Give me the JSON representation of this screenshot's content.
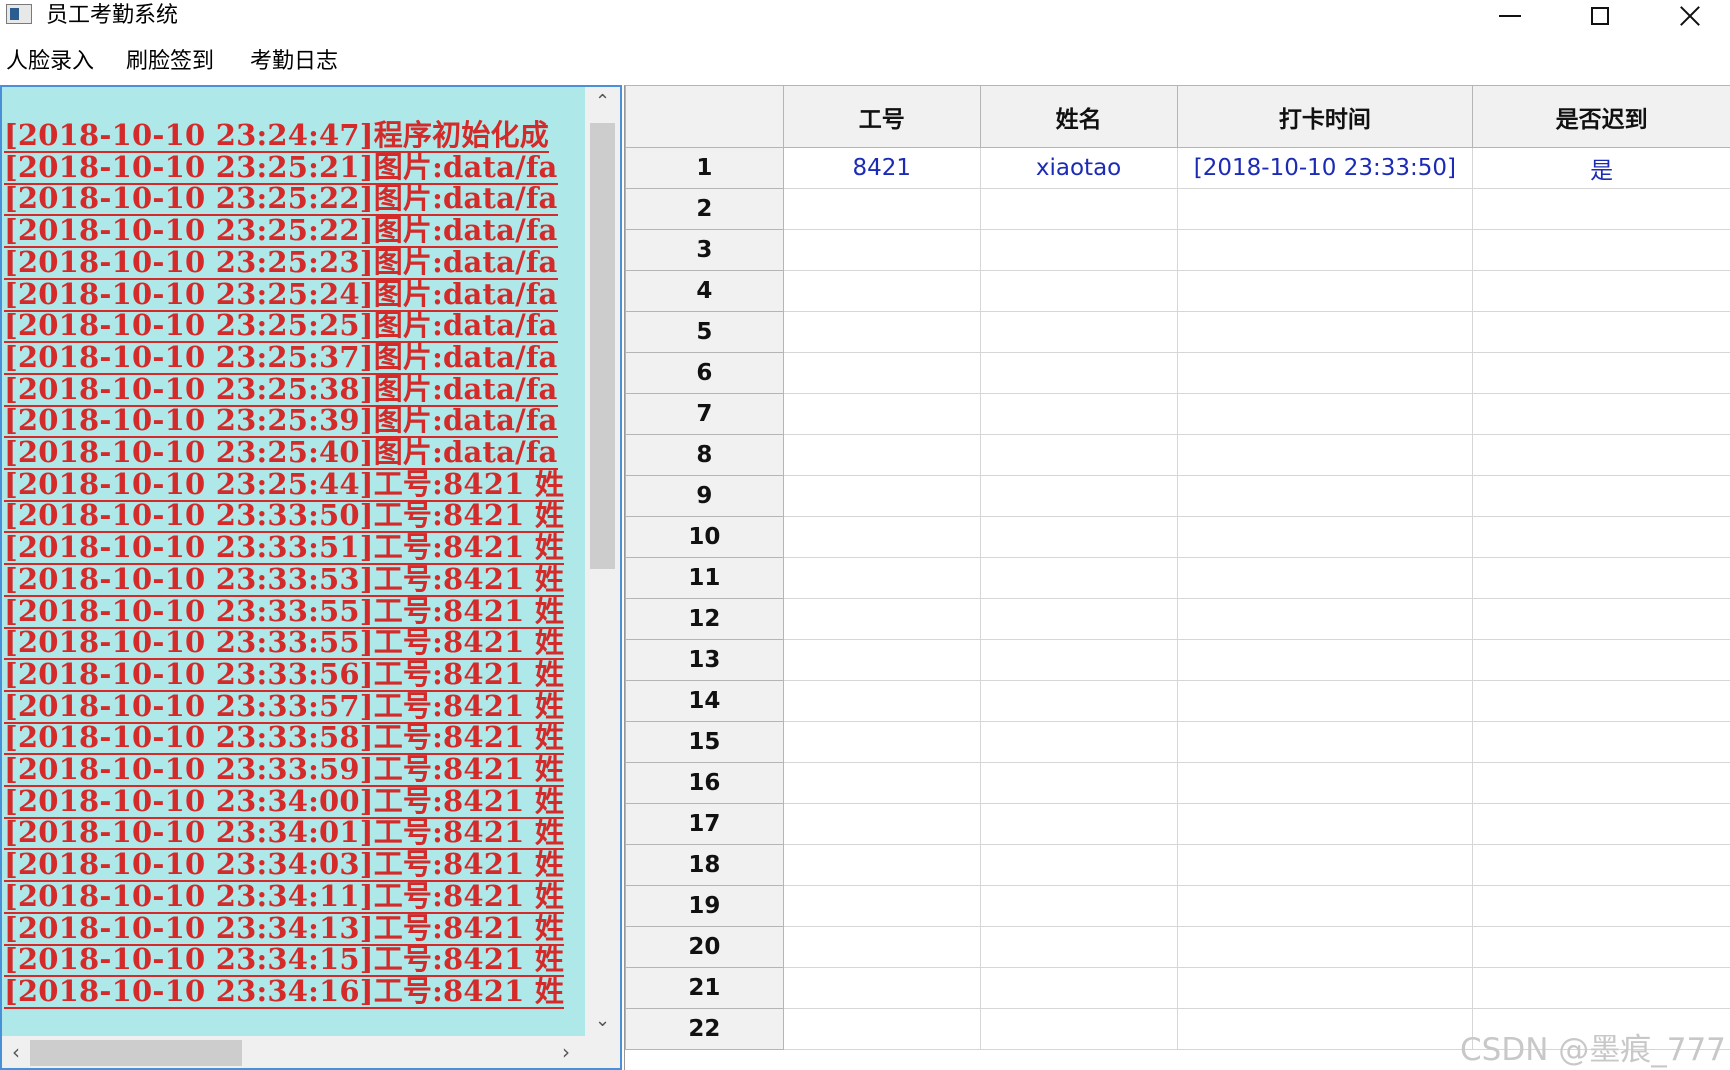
{
  "window": {
    "title": "员工考勤系统"
  },
  "menu": [
    "人脸录入",
    "刷脸签到",
    "考勤日志"
  ],
  "log": {
    "lines": [
      "[2018-10-10 23:24:47]程序初始化成",
      "[2018-10-10 23:25:21]图片:data/fa",
      "[2018-10-10 23:25:22]图片:data/fa",
      "[2018-10-10 23:25:22]图片:data/fa",
      "[2018-10-10 23:25:23]图片:data/fa",
      "[2018-10-10 23:25:24]图片:data/fa",
      "[2018-10-10 23:25:25]图片:data/fa",
      "[2018-10-10 23:25:37]图片:data/fa",
      "[2018-10-10 23:25:38]图片:data/fa",
      "[2018-10-10 23:25:39]图片:data/fa",
      "[2018-10-10 23:25:40]图片:data/fa",
      "[2018-10-10 23:25:44]工号:8421 姓",
      "[2018-10-10 23:33:50]工号:8421 姓",
      "[2018-10-10 23:33:51]工号:8421 姓",
      "[2018-10-10 23:33:53]工号:8421 姓",
      "[2018-10-10 23:33:55]工号:8421 姓",
      "[2018-10-10 23:33:55]工号:8421 姓",
      "[2018-10-10 23:33:56]工号:8421 姓",
      "[2018-10-10 23:33:57]工号:8421 姓",
      "[2018-10-10 23:33:58]工号:8421 姓",
      "[2018-10-10 23:33:59]工号:8421 姓",
      "[2018-10-10 23:34:00]工号:8421 姓",
      "[2018-10-10 23:34:01]工号:8421 姓",
      "[2018-10-10 23:34:03]工号:8421 姓",
      "[2018-10-10 23:34:11]工号:8421 姓",
      "[2018-10-10 23:34:13]工号:8421 姓",
      "[2018-10-10 23:34:15]工号:8421 姓",
      "[2018-10-10 23:34:16]工号:8421 姓"
    ]
  },
  "table": {
    "columns": [
      "工号",
      "姓名",
      "打卡时间",
      "是否迟到"
    ],
    "rows": [
      {
        "id": "8421",
        "name": "xiaotao",
        "time": "[2018-10-10 23:33:50]",
        "late": "是"
      }
    ],
    "row_numbers": [
      "1",
      "2",
      "3",
      "4",
      "5",
      "6",
      "7",
      "8",
      "9",
      "10",
      "11",
      "12",
      "13",
      "14",
      "15",
      "16",
      "17",
      "18",
      "19",
      "20",
      "21",
      "22"
    ]
  },
  "watermark": "CSDN @墨痕_777",
  "colors": {
    "log_bg": "#aee8e8",
    "log_text": "#d42a2a",
    "cell_text": "#1c2bb5",
    "header_bg": "#f1f1f1"
  }
}
